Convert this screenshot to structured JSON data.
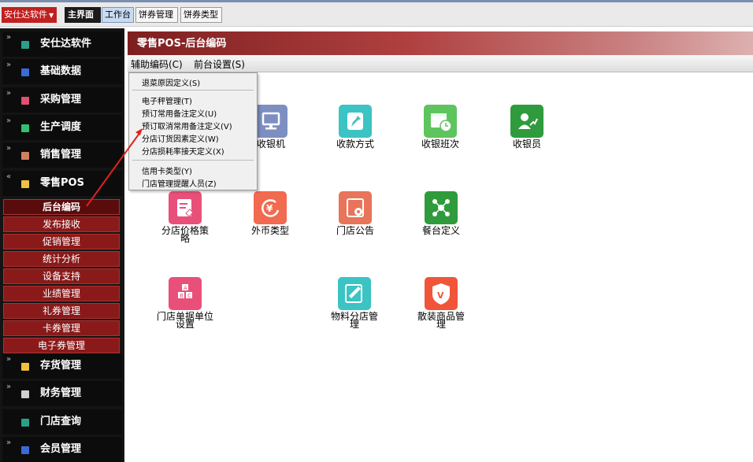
{
  "topbar": {
    "brand_label": "安仕达软件",
    "tabs": [
      "主界面",
      "工作台",
      "饼券管理",
      "饼券类型"
    ]
  },
  "sidebar": {
    "modules_top": [
      {
        "label": "安仕达软件",
        "color": "#2aa08a"
      },
      {
        "label": "基础数据",
        "color": "#3a6bd6"
      },
      {
        "label": "采购管理",
        "color": "#e05070"
      },
      {
        "label": "生产调度",
        "color": "#30c070"
      },
      {
        "label": "销售管理",
        "color": "#d08060"
      },
      {
        "label": "零售POS",
        "color": "#f0c040"
      }
    ],
    "pos_subitems": [
      "后台编码",
      "发布接收",
      "促销管理",
      "统计分析",
      "设备支持",
      "业绩管理",
      "礼券管理",
      "卡券管理",
      "电子券管理"
    ],
    "modules_bottom": [
      {
        "label": "存货管理",
        "color": "#f0c040"
      },
      {
        "label": "财务管理",
        "color": "#d0d0d0"
      },
      {
        "label": "门店查询",
        "color": "#2aa08a"
      },
      {
        "label": "会员管理",
        "color": "#3a6bd6"
      }
    ]
  },
  "main": {
    "header_title": "零售POS-后台编码",
    "menu": [
      "辅助编码(C)",
      "前台设置(S)"
    ],
    "dropdown_items": [
      "退菜原因定义(S)",
      "电子秤管理(T)",
      "预订常用备注定义(U)",
      "预订取消常用备注定义(V)",
      "分店订货因素定义(W)",
      "分店损耗率接天定义(X)",
      "信用卡类型(Y)",
      "门店管理提醒人员(Z)"
    ],
    "tiles": [
      {
        "label": "收银机",
        "color": "#7d8fc0",
        "icon": "monitor-icon"
      },
      {
        "label": "收款方式",
        "color": "#3cc3c3",
        "icon": "pin-icon"
      },
      {
        "label": "收银班次",
        "color": "#5ec45e",
        "icon": "calendar-clock-icon"
      },
      {
        "label": "收银员",
        "color": "#2f9b3c",
        "icon": "user-chart-icon"
      },
      {
        "label": "分店价格策略",
        "color": "#e8507a",
        "icon": "edit-doc-icon"
      },
      {
        "label": "外币类型",
        "color": "#f26a4f",
        "icon": "currency-yen-icon"
      },
      {
        "label": "门店公告",
        "color": "#e8745a",
        "icon": "gear-doc-icon"
      },
      {
        "label": "餐台定义",
        "color": "#2f9b3c",
        "icon": "network-icon"
      },
      {
        "label": "门店单据单位设置",
        "color": "#e8507a",
        "icon": "abc-blocks-icon"
      },
      {
        "label": "物料分店管理",
        "color": "#3cc3c3",
        "icon": "edit-grid-icon"
      },
      {
        "label": "散装商品管理",
        "color": "#f0553a",
        "icon": "shield-v-icon"
      }
    ]
  }
}
